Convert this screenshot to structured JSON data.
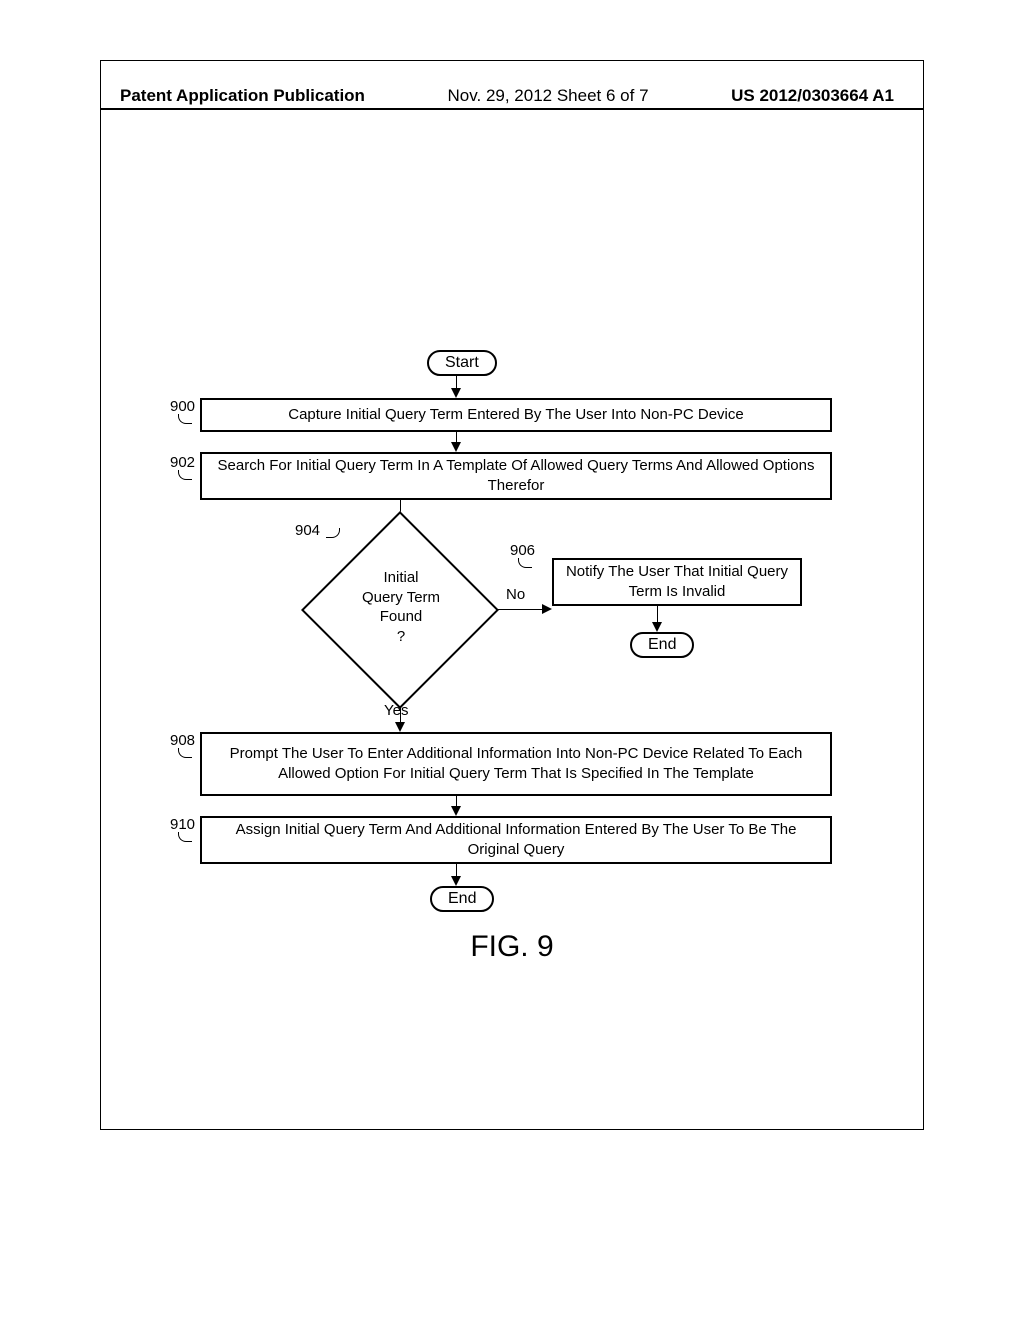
{
  "header": {
    "left": "Patent Application Publication",
    "center": "Nov. 29, 2012  Sheet 6 of 7",
    "right": "US 2012/0303664 A1"
  },
  "flowchart": {
    "start": "Start",
    "step900": {
      "ref": "900",
      "text": "Capture Initial Query Term Entered By The User Into Non-PC Device"
    },
    "step902": {
      "ref": "902",
      "text": "Search For Initial Query Term In A Template Of Allowed Query Terms And Allowed Options Therefor"
    },
    "decision904": {
      "ref": "904",
      "text": "Initial\nQuery Term\nFound\n?"
    },
    "edge_yes": "Yes",
    "edge_no": "No",
    "step906": {
      "ref": "906",
      "text": "Notify The User That Initial Query Term Is Invalid"
    },
    "end1": "End",
    "step908": {
      "ref": "908",
      "text": "Prompt The User To Enter Additional Information Into Non-PC Device Related To Each Allowed Option For Initial Query Term That Is Specified In The Template"
    },
    "step910": {
      "ref": "910",
      "text": "Assign Initial Query Term And Additional Information Entered By The User To Be The Original Query"
    },
    "end2": "End",
    "figure_label": "FIG. 9"
  }
}
